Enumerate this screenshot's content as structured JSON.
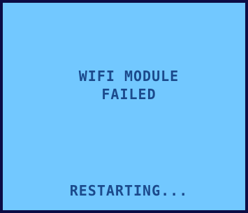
{
  "screen": {
    "error_line_1": "WIFI MODULE",
    "error_line_2": "FAILED",
    "status_text": "RESTARTING...",
    "background_color": "#72c8ff",
    "text_color": "#1b4a8c",
    "border_color": "#0c0c44"
  }
}
